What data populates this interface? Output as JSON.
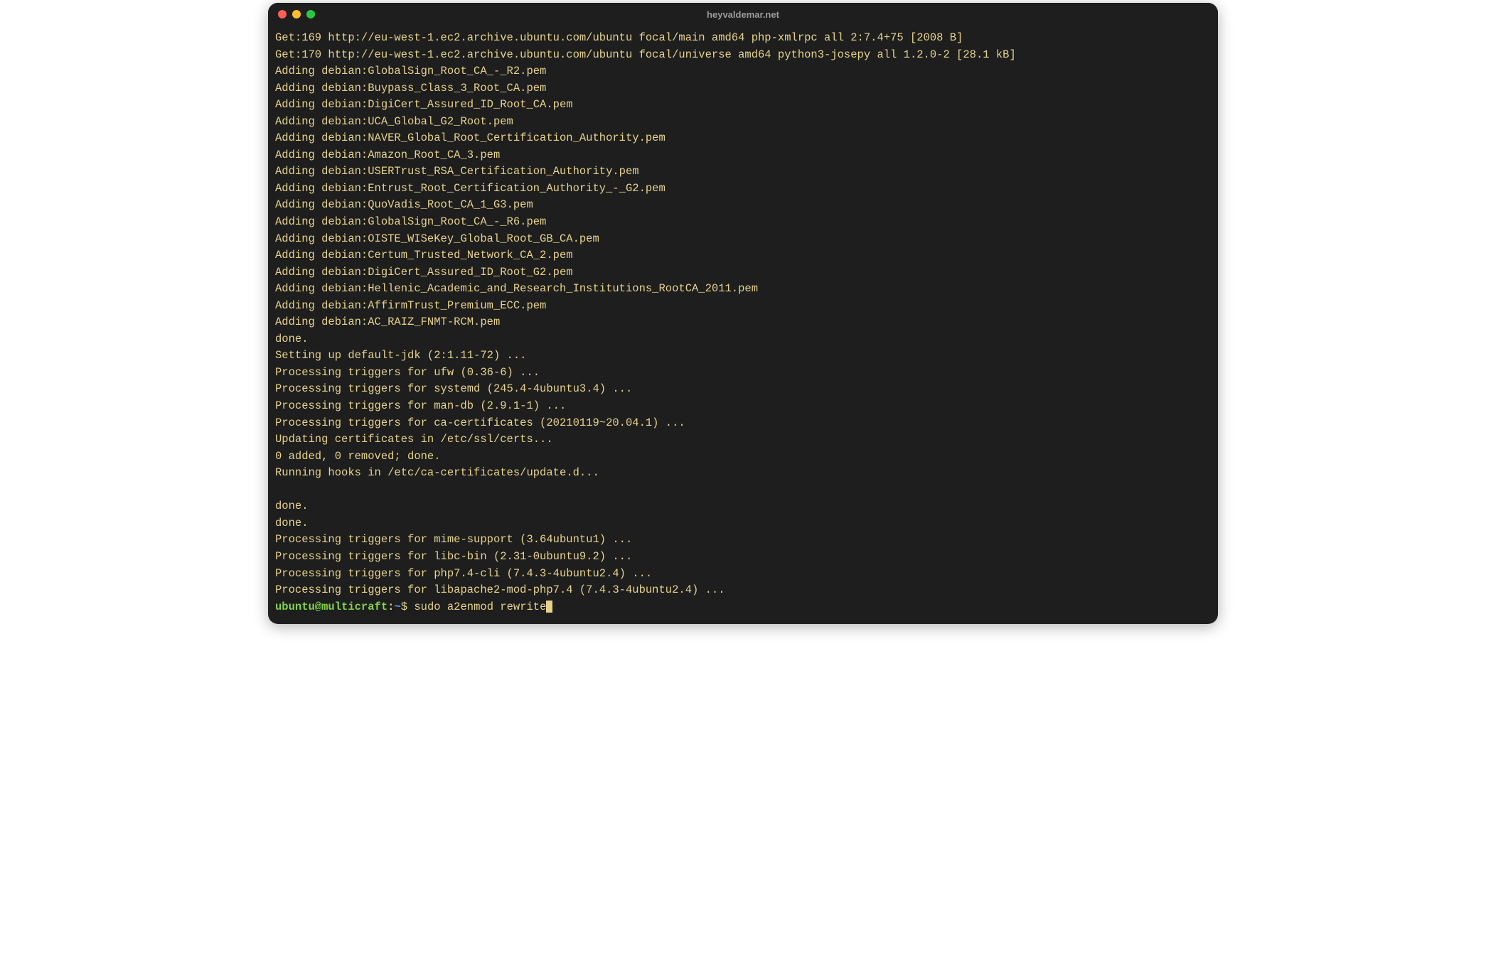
{
  "window": {
    "title": "heyvaldemar.net"
  },
  "output": {
    "l0": "Get:169 http://eu-west-1.ec2.archive.ubuntu.com/ubuntu focal/main amd64 php-xmlrpc all 2:7.4+75 [2008 B]",
    "l1": "Get:170 http://eu-west-1.ec2.archive.ubuntu.com/ubuntu focal/universe amd64 python3-josepy all 1.2.0-2 [28.1 kB]",
    "l2": "Adding debian:GlobalSign_Root_CA_-_R2.pem",
    "l3": "Adding debian:Buypass_Class_3_Root_CA.pem",
    "l4": "Adding debian:DigiCert_Assured_ID_Root_CA.pem",
    "l5": "Adding debian:UCA_Global_G2_Root.pem",
    "l6": "Adding debian:NAVER_Global_Root_Certification_Authority.pem",
    "l7": "Adding debian:Amazon_Root_CA_3.pem",
    "l8": "Adding debian:USERTrust_RSA_Certification_Authority.pem",
    "l9": "Adding debian:Entrust_Root_Certification_Authority_-_G2.pem",
    "l10": "Adding debian:QuoVadis_Root_CA_1_G3.pem",
    "l11": "Adding debian:GlobalSign_Root_CA_-_R6.pem",
    "l12": "Adding debian:OISTE_WISeKey_Global_Root_GB_CA.pem",
    "l13": "Adding debian:Certum_Trusted_Network_CA_2.pem",
    "l14": "Adding debian:DigiCert_Assured_ID_Root_G2.pem",
    "l15": "Adding debian:Hellenic_Academic_and_Research_Institutions_RootCA_2011.pem",
    "l16": "Adding debian:AffirmTrust_Premium_ECC.pem",
    "l17": "Adding debian:AC_RAIZ_FNMT-RCM.pem",
    "l18": "done.",
    "l19": "Setting up default-jdk (2:1.11-72) ...",
    "l20": "Processing triggers for ufw (0.36-6) ...",
    "l21": "Processing triggers for systemd (245.4-4ubuntu3.4) ...",
    "l22": "Processing triggers for man-db (2.9.1-1) ...",
    "l23": "Processing triggers for ca-certificates (20210119~20.04.1) ...",
    "l24": "Updating certificates in /etc/ssl/certs...",
    "l25": "0 added, 0 removed; done.",
    "l26": "Running hooks in /etc/ca-certificates/update.d...",
    "l27": "",
    "l28": "done.",
    "l29": "done.",
    "l30": "Processing triggers for mime-support (3.64ubuntu1) ...",
    "l31": "Processing triggers for libc-bin (2.31-0ubuntu9.2) ...",
    "l32": "Processing triggers for php7.4-cli (7.4.3-4ubuntu2.4) ...",
    "l33": "Processing triggers for libapache2-mod-php7.4 (7.4.3-4ubuntu2.4) ..."
  },
  "prompt": {
    "userhost": "ubuntu@multicraft",
    "sep": ":",
    "path": "~",
    "dollar": "$ ",
    "command": "sudo a2enmod rewrite"
  }
}
